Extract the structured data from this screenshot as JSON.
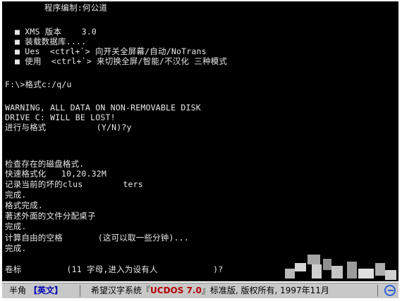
{
  "terminal": {
    "header": "程序编制:何公道",
    "features": [
      "XMS 版本    3.0",
      "装载数据库....",
      "Ues  <ctrl+`> 向开关全屏幕/自动/NoTrans",
      "使用  <ctrl+`> 来切换全屏/智能/不汉化 三种模式"
    ],
    "prompt_command": "F:\\>格式c:/q/u",
    "warning_line1": "WARNING, ALL DATA ON NON-REMOVABLE DISK",
    "warning_line2": "DRIVE C: WILL BE LOST!",
    "confirm_prompt": "进行与格式          (Y/N)?y",
    "check_existing": "检查存在的磁盘格式.",
    "quick_format": "快速格式化   10,20.32M",
    "record_bad": "记录当前的坏的clus        ters",
    "done1": "完成.",
    "format_done": "格式完成.",
    "writing_fat": "著述外面的文件分配桌子",
    "done2": "完成.",
    "calc_free": "计算自由的空格       (这可以取一些分钟)...",
    "done3": "完成.",
    "volume_prompt": "卷标         (11 字母,进入为设有人           )?"
  },
  "statusbar": {
    "half_width": "半角",
    "mode": "【英文】",
    "system_prefix": "希望汉字系统『",
    "product": "UCDOS 7.0",
    "system_suffix": "』标准版, 版权所有, 1997年11月",
    "icon": "ucdos-logo-icon"
  },
  "colors": {
    "terminal_bg": "#000000",
    "terminal_text": "#e8e8e8",
    "statusbar_bg": "#c8c8c8",
    "mode_color": "#0000b4",
    "product_color": "#b40000"
  }
}
